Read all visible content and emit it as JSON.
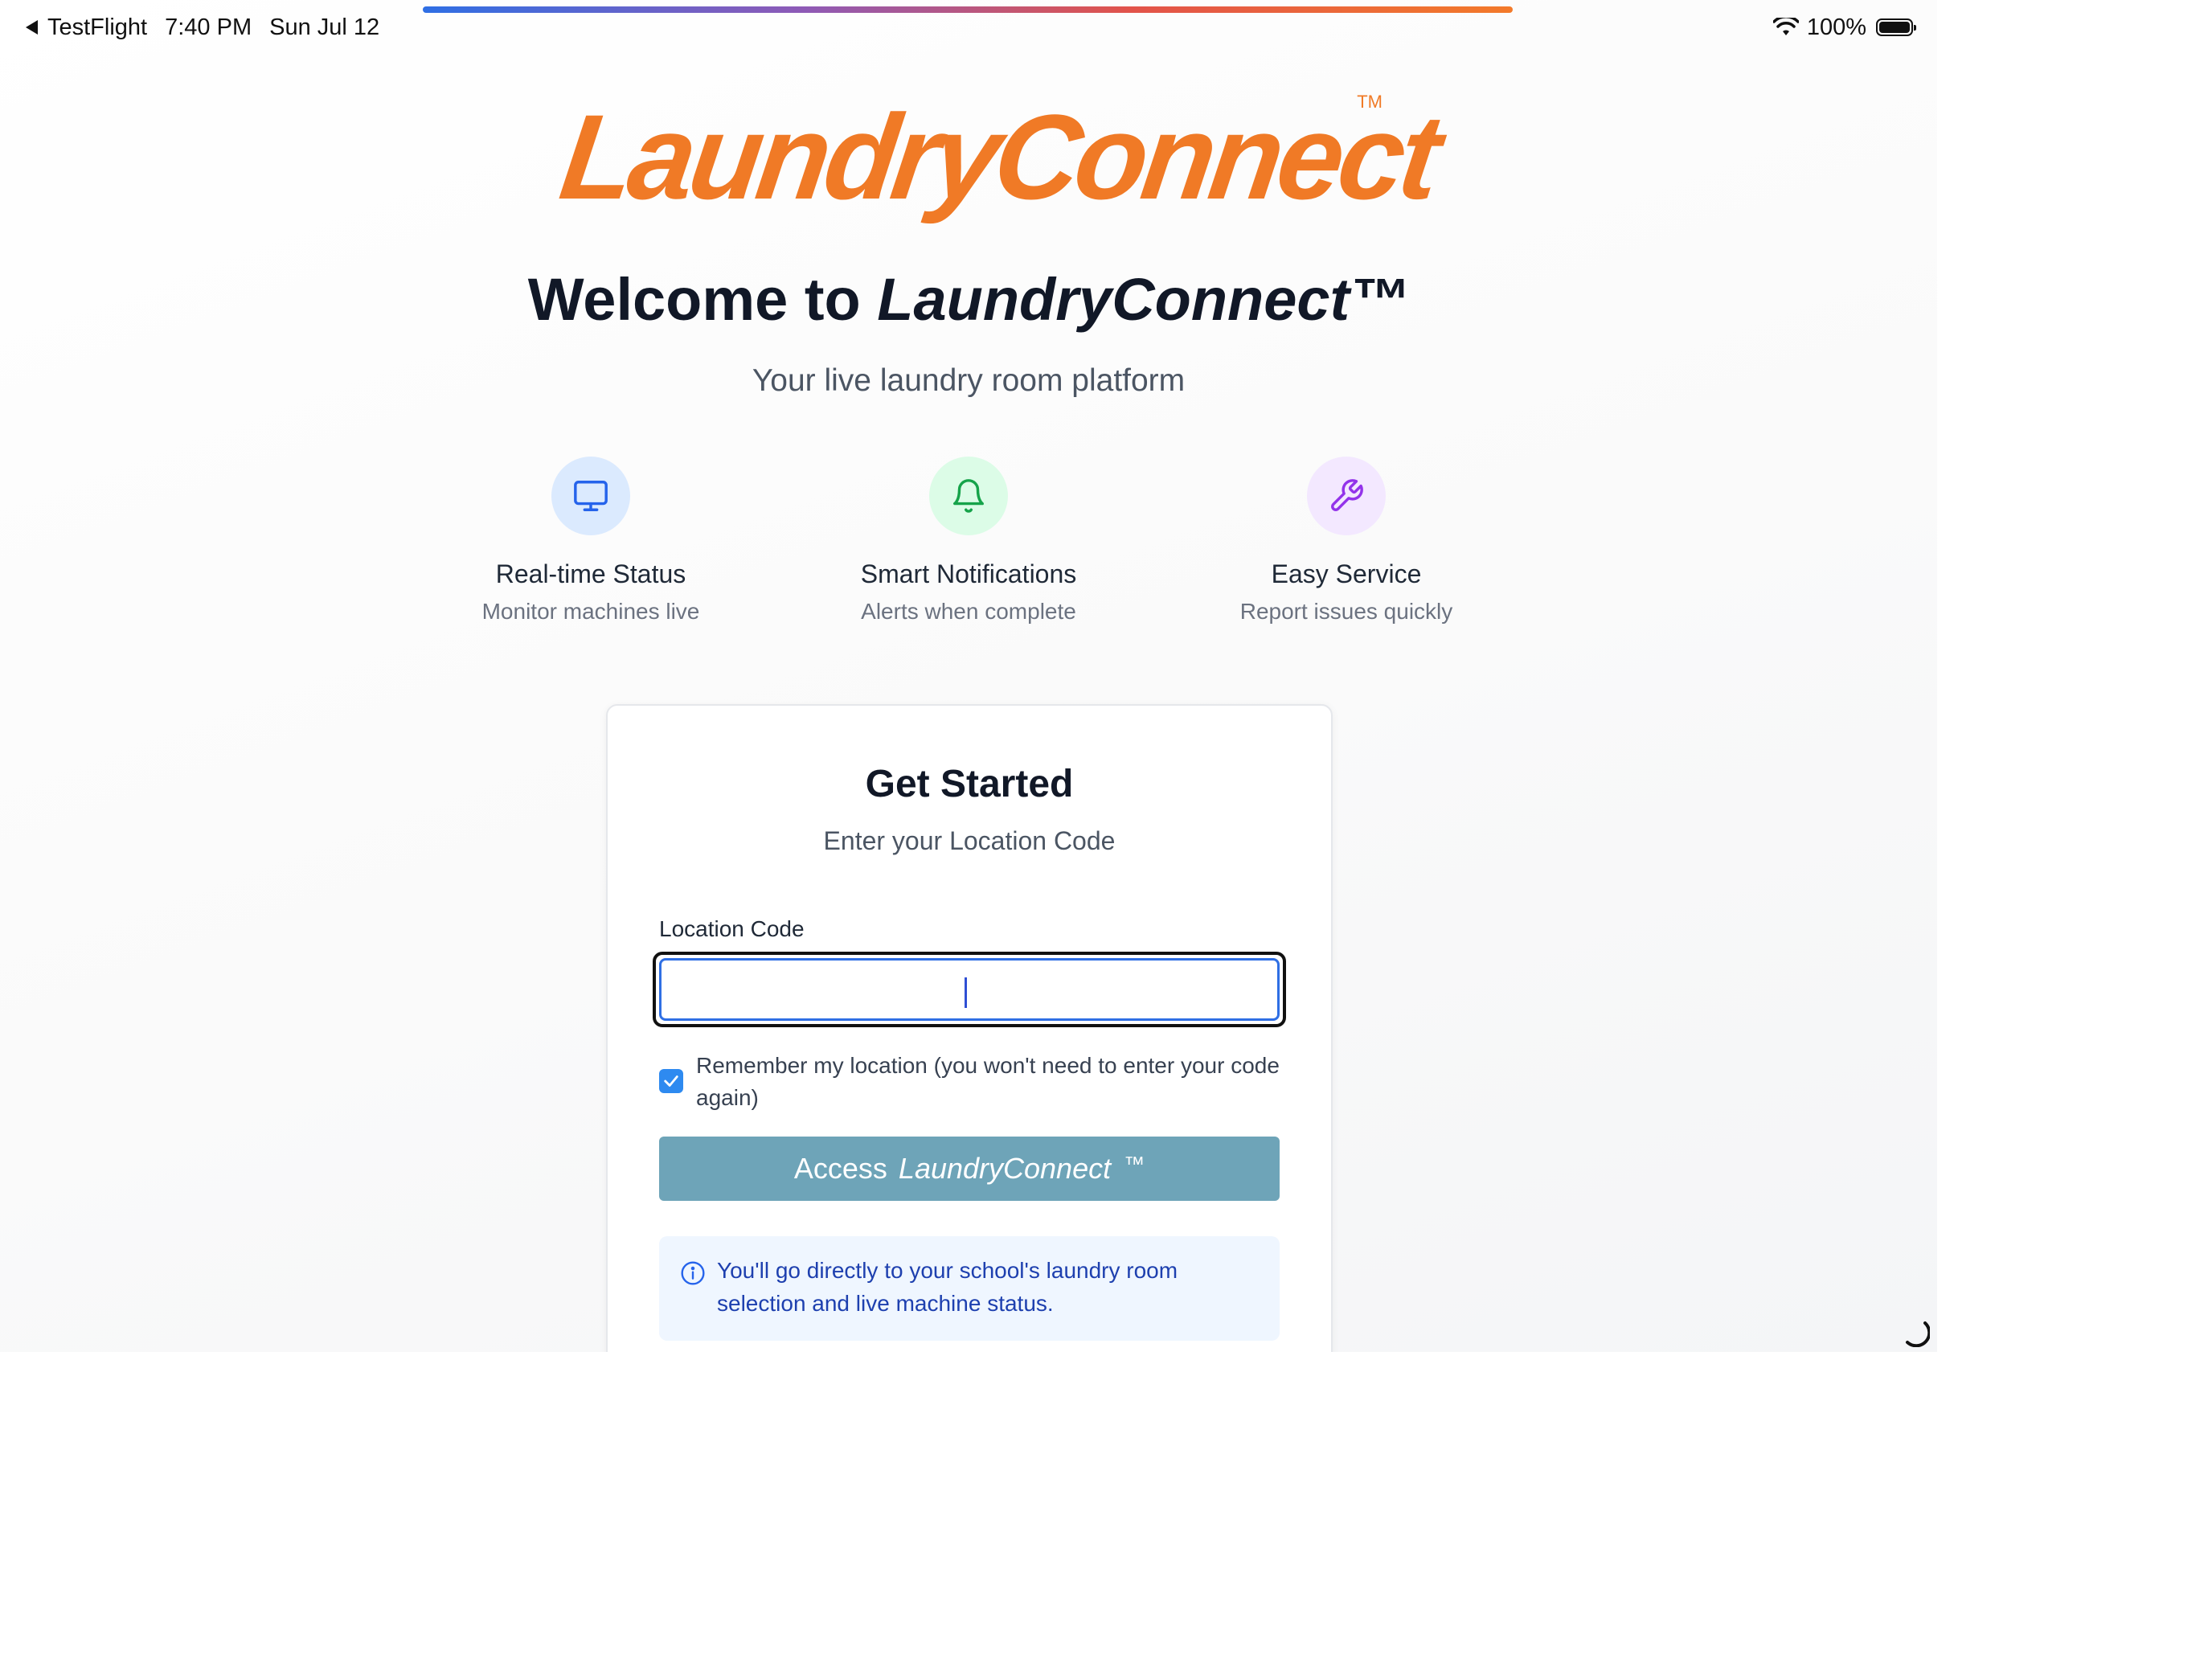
{
  "status_bar": {
    "back_app": "TestFlight",
    "time": "7:40 PM",
    "date": "Sun Jul 12",
    "battery": "100%"
  },
  "logo": {
    "text": "LaundryConnect",
    "tm": "TM"
  },
  "hero": {
    "welcome_prefix": "Welcome to ",
    "welcome_brand": "LaundryConnect™",
    "subtitle": "Your live laundry room platform"
  },
  "features": [
    {
      "icon": "monitor-icon",
      "title": "Real-time Status",
      "desc": "Monitor machines live",
      "color": "#2563eb",
      "bg": "#dbeafe"
    },
    {
      "icon": "bell-icon",
      "title": "Smart Notifications",
      "desc": "Alerts when complete",
      "color": "#16a34a",
      "bg": "#dcfce7"
    },
    {
      "icon": "wrench-icon",
      "title": "Easy Service",
      "desc": "Report issues quickly",
      "color": "#9333ea",
      "bg": "#f3e8ff"
    }
  ],
  "card": {
    "title": "Get Started",
    "subtitle": "Enter your Location Code",
    "field_label": "Location Code",
    "field_value": "",
    "remember_label": "Remember my location (you won't need to enter your code again)",
    "remember_checked": true,
    "button_prefix": "Access",
    "button_brand": "LaundryConnect",
    "button_tm": "™",
    "info_text": "You'll go directly to your school's laundry room selection and live machine status."
  },
  "colors": {
    "brand_orange": "#f07a26",
    "button": "#6ea4b8",
    "focus_blue": "#2f6fe4",
    "info_bg": "#eff6ff",
    "info_text": "#1e40af"
  }
}
